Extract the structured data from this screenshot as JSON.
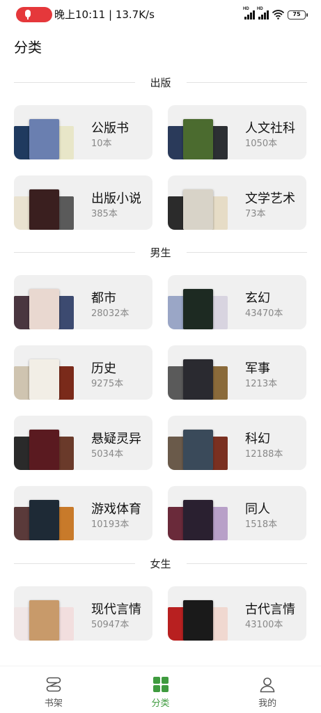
{
  "status_bar": {
    "time_speed": "晚上10:11 | 13.7K/s",
    "battery": "75",
    "signal_label": "HD",
    "colors": {
      "record": "#e5383b"
    }
  },
  "page": {
    "title": "分类"
  },
  "sections": [
    {
      "title": "出版",
      "cards": [
        {
          "name": "公版书",
          "count": "10本",
          "covers": [
            "#1f3a5f",
            "#6a7fb0",
            "#e8e6c8"
          ]
        },
        {
          "name": "人文社科",
          "count": "1050本",
          "covers": [
            "#2a3a5a",
            "#4b6b2f",
            "#2c2f33"
          ]
        },
        {
          "name": "出版小说",
          "count": "385本",
          "covers": [
            "#e9e2d0",
            "#3a1f1f",
            "#5a5a5a"
          ]
        },
        {
          "name": "文学艺术",
          "count": "73本",
          "covers": [
            "#2b2b2b",
            "#d8d3c8",
            "#e6dcc6"
          ]
        }
      ]
    },
    {
      "title": "男生",
      "cards": [
        {
          "name": "都市",
          "count": "28032本",
          "covers": [
            "#4a3640",
            "#e9d8d0",
            "#3c4a70"
          ]
        },
        {
          "name": "玄幻",
          "count": "43470本",
          "covers": [
            "#9aa6c6",
            "#1d2a22",
            "#d8d4e0"
          ]
        },
        {
          "name": "历史",
          "count": "9275本",
          "covers": [
            "#cfc4b0",
            "#f2eee6",
            "#7a2a1a"
          ]
        },
        {
          "name": "军事",
          "count": "1213本",
          "covers": [
            "#5a5a5a",
            "#2a2a30",
            "#8a6a3a"
          ]
        },
        {
          "name": "悬疑灵异",
          "count": "5034本",
          "covers": [
            "#2a2a2a",
            "#5a1a20",
            "#6a3a2a"
          ]
        },
        {
          "name": "科幻",
          "count": "12188本",
          "covers": [
            "#6a5a4a",
            "#3a4a5a",
            "#7a3020"
          ]
        },
        {
          "name": "游戏体育",
          "count": "10193本",
          "covers": [
            "#5a3a3a",
            "#1e2a36",
            "#c87a2a"
          ]
        },
        {
          "name": "同人",
          "count": "1518本",
          "covers": [
            "#6a2a3a",
            "#2a2030",
            "#b8a0c8"
          ]
        }
      ]
    },
    {
      "title": "女生",
      "cards": [
        {
          "name": "现代言情",
          "count": "50947本",
          "covers": [
            "#f0e6e6",
            "#c89a6a",
            "#f2dede"
          ]
        },
        {
          "name": "古代言情",
          "count": "43100本",
          "covers": [
            "#b82020",
            "#1a1a1a",
            "#f0d8d0"
          ]
        }
      ]
    }
  ],
  "bottom_nav": {
    "items": [
      {
        "label": "书架",
        "icon": "bookshelf-icon"
      },
      {
        "label": "分类",
        "icon": "category-grid-icon"
      },
      {
        "label": "我的",
        "icon": "person-icon"
      }
    ],
    "active_color": "#3f9b3f"
  }
}
